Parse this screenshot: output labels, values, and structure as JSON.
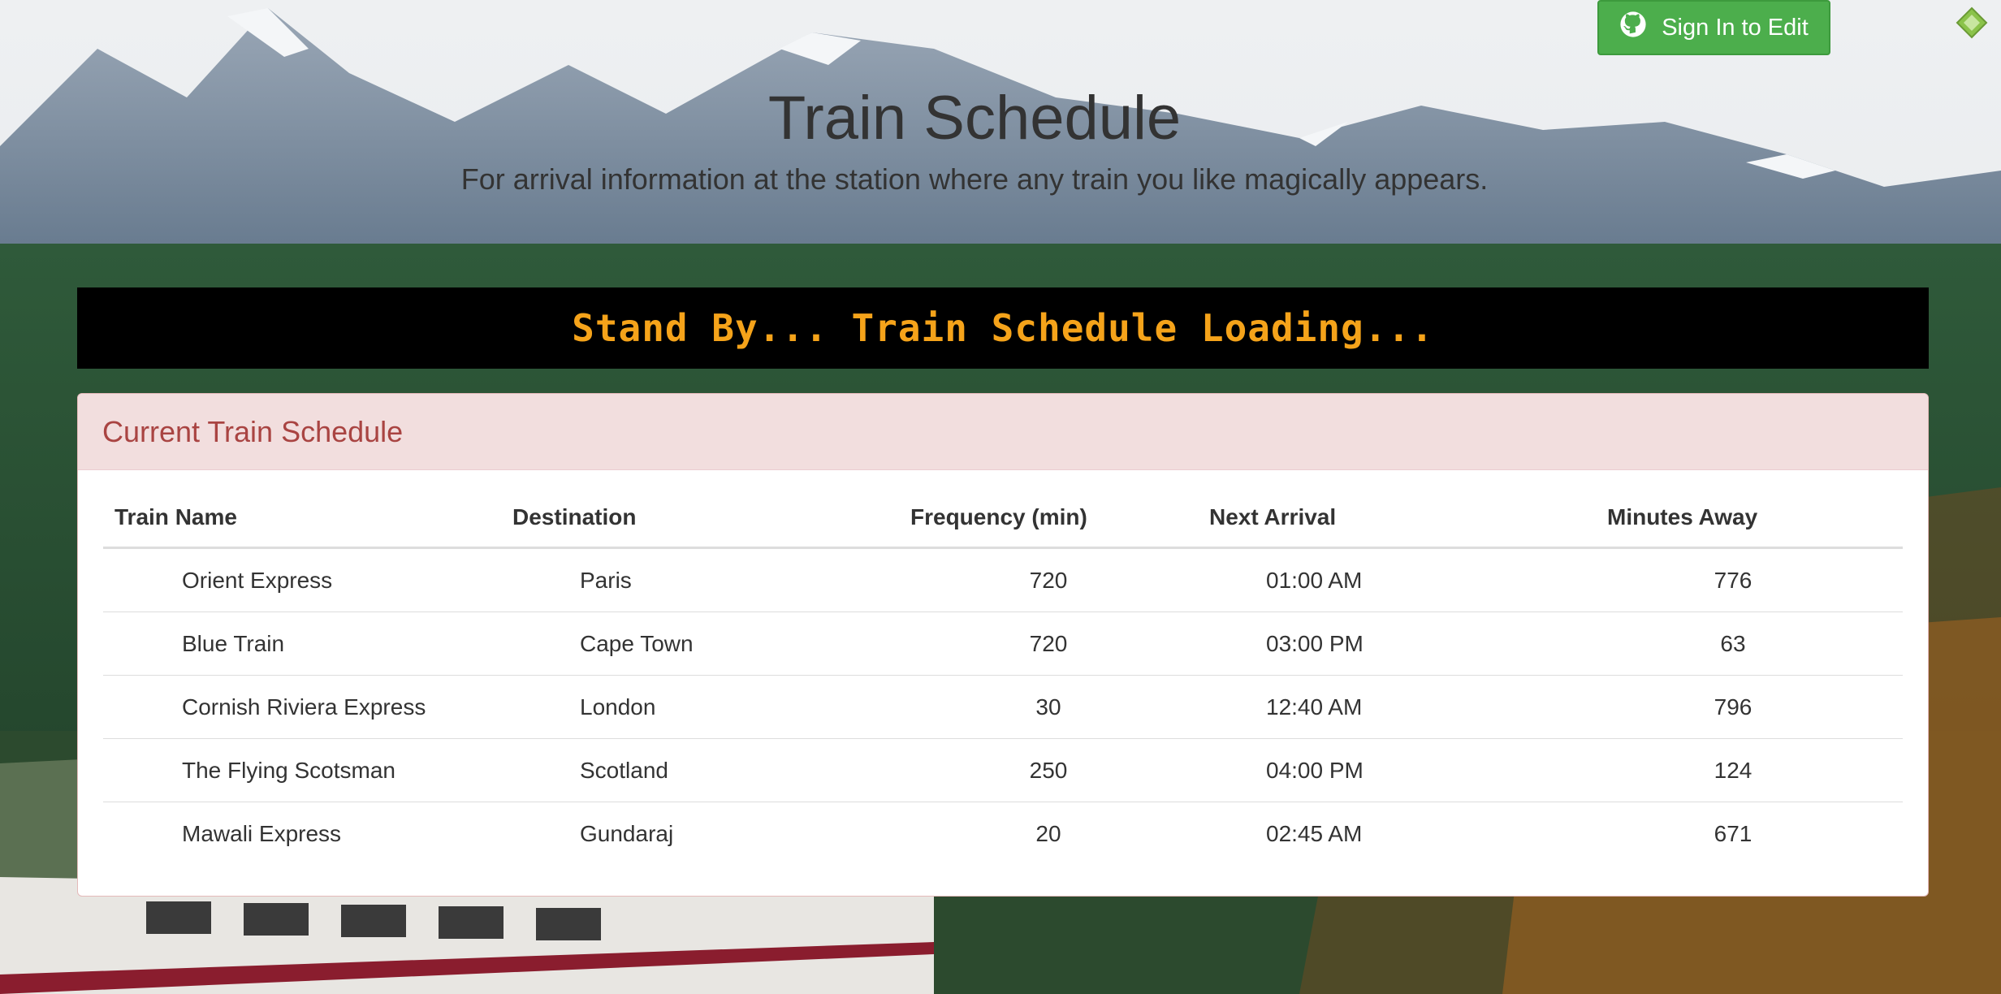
{
  "header": {
    "title": "Train Schedule",
    "subtitle": "For arrival information at the station where any train you like magically appears.",
    "signin_label": "Sign In to Edit",
    "signin_icon": "github-icon",
    "corner_badge_icon": "diamond-badge-icon"
  },
  "banner": {
    "text": "Stand By... Train Schedule Loading..."
  },
  "panel": {
    "title": "Current Train Schedule",
    "columns": [
      "Train Name",
      "Destination",
      "Frequency (min)",
      "Next Arrival",
      "Minutes Away"
    ],
    "rows": [
      {
        "name": "Orient Express",
        "destination": "Paris",
        "frequency": "720",
        "next": "01:00 AM",
        "away": "776"
      },
      {
        "name": "Blue Train",
        "destination": "Cape Town",
        "frequency": "720",
        "next": "03:00 PM",
        "away": "63"
      },
      {
        "name": "Cornish Riviera Express",
        "destination": "London",
        "frequency": "30",
        "next": "12:40 AM",
        "away": "796"
      },
      {
        "name": "The Flying Scotsman",
        "destination": "Scotland",
        "frequency": "250",
        "next": "04:00 PM",
        "away": "124"
      },
      {
        "name": "Mawali Express",
        "destination": "Gundaraj",
        "frequency": "20",
        "next": "02:45 AM",
        "away": "671"
      }
    ]
  },
  "colors": {
    "signin_bg": "#4cae4c",
    "banner_bg": "#000000",
    "banner_text": "#f5a31a",
    "panel_head_bg": "#f2dede",
    "panel_head_text": "#a94442"
  }
}
